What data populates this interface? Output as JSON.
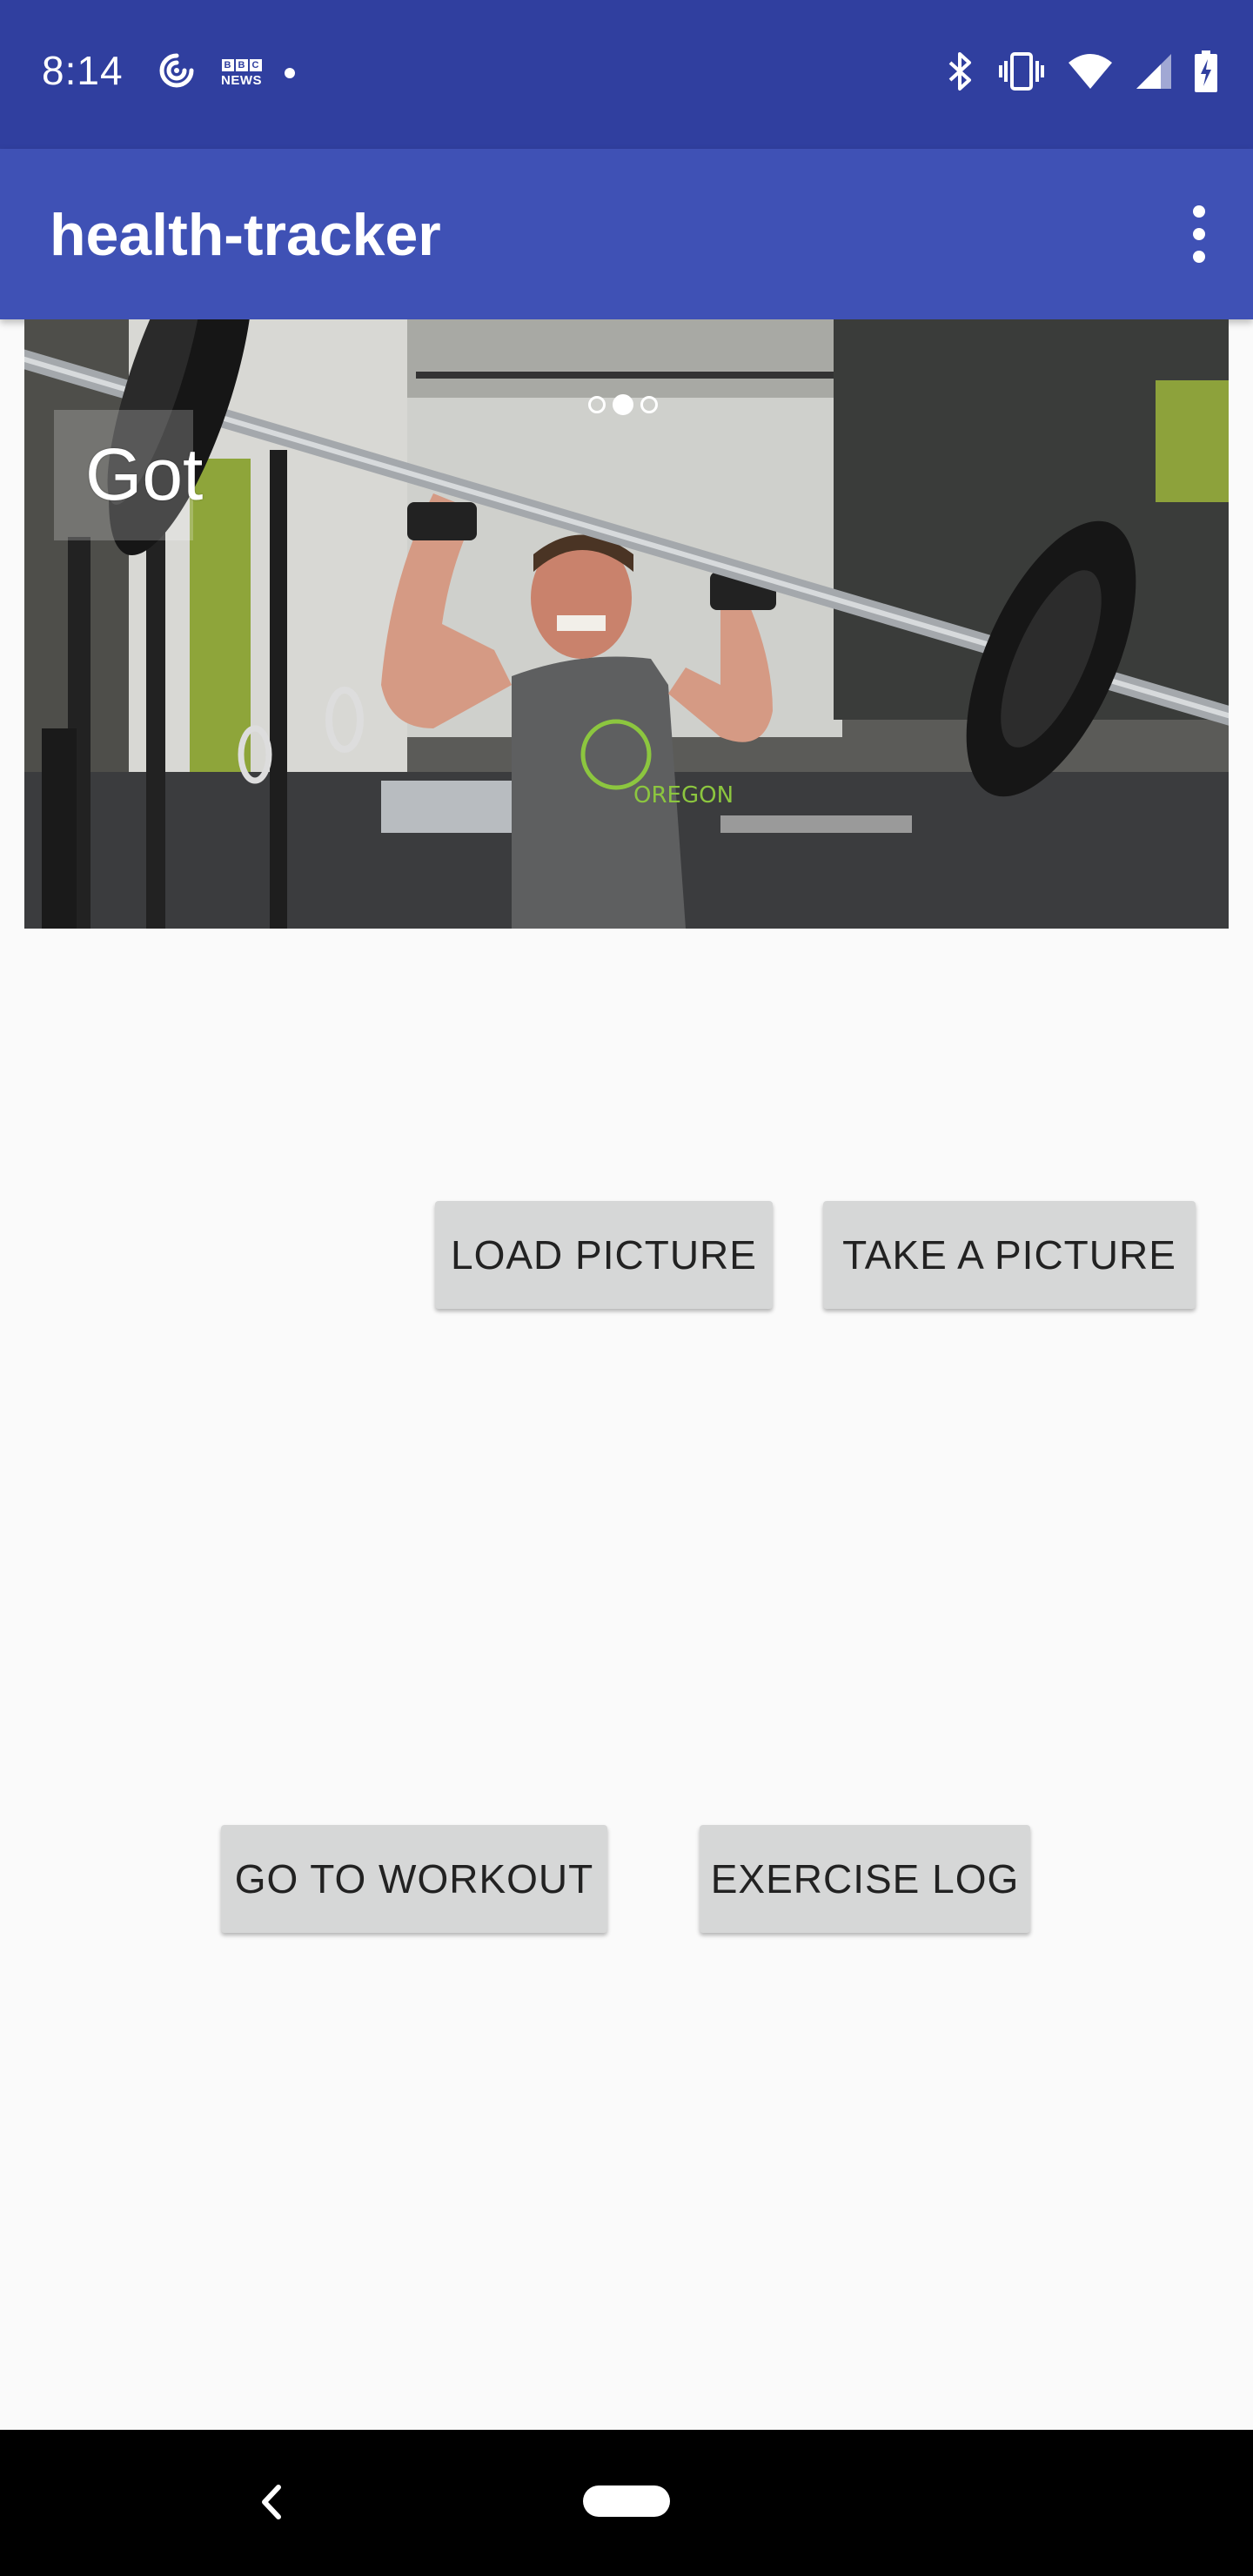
{
  "status_bar": {
    "time": "8:14",
    "left_icons": [
      "podcast-icon",
      "bbc-news-icon",
      "notification-dot-icon"
    ],
    "bbc_label": "NEWS",
    "right_icons": [
      "bluetooth-icon",
      "vibrate-icon",
      "wifi-icon",
      "cell-signal-icon",
      "battery-charging-icon"
    ]
  },
  "app_bar": {
    "title": "health-tracker",
    "menu_icon": "more-vert-icon"
  },
  "carousel": {
    "caption": "Got",
    "page_count": 3,
    "active_index": 1
  },
  "buttons": {
    "load_picture": "LOAD PICTURE",
    "take_picture": "TAKE A PICTURE",
    "go_to_workout": "GO TO WORKOUT",
    "exercise_log": "EXERCISE LOG"
  },
  "nav_bar": {
    "back_icon": "back-chevron-icon",
    "home_icon": "home-pill-icon"
  },
  "colors": {
    "status_bar": "#303f9f",
    "app_bar": "#3f51b5",
    "button_bg": "#d6d7d7",
    "background": "#fafafa"
  }
}
